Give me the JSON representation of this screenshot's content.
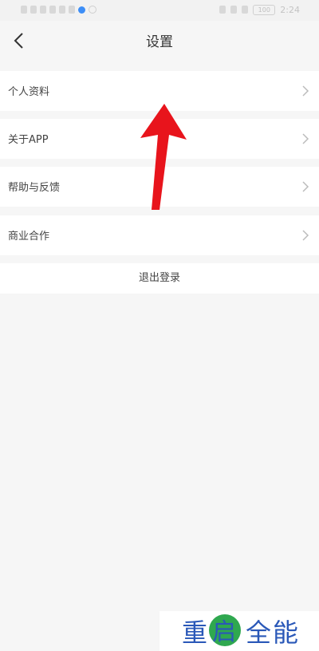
{
  "status_bar": {
    "battery": "100",
    "time": "2:24"
  },
  "nav": {
    "title": "设置"
  },
  "menu": {
    "items": [
      {
        "label": "个人资料"
      },
      {
        "label": "关于APP"
      },
      {
        "label": "帮助与反馈"
      },
      {
        "label": "商业合作"
      }
    ]
  },
  "logout": {
    "label": "退出登录"
  },
  "watermark": {
    "text": "重启全能"
  },
  "colors": {
    "page_bg": "#f6f6f6",
    "row_bg": "#ffffff",
    "annotation_arrow": "#e8141c",
    "watermark_green": "#2fa84f",
    "watermark_blue": "#2a58b8",
    "status_blue": "#3d8ef7"
  },
  "icons": {
    "back": "chevron-left-icon",
    "row_arrow": "chevron-right-icon"
  }
}
